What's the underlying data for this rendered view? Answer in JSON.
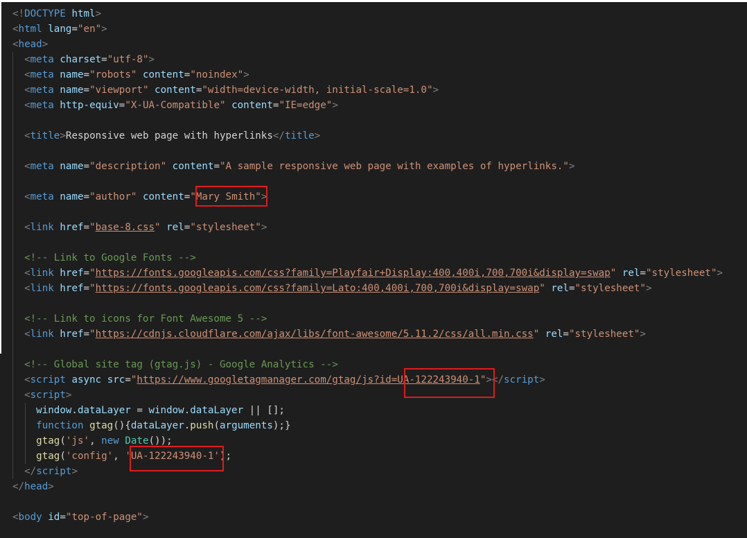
{
  "editor": {
    "lines": [
      {
        "parts": [
          {
            "c": "t-punc",
            "t": "<!"
          },
          {
            "c": "t-doctype",
            "t": "DOCTYPE"
          },
          {
            "c": "t-text",
            "t": " "
          },
          {
            "c": "t-html",
            "t": "html"
          },
          {
            "c": "t-punc",
            "t": ">"
          }
        ]
      },
      {
        "parts": [
          {
            "c": "t-punc",
            "t": "<"
          },
          {
            "c": "t-tag",
            "t": "html"
          },
          {
            "c": "t-text",
            "t": " "
          },
          {
            "c": "t-attr",
            "t": "lang"
          },
          {
            "c": "t-text",
            "t": "="
          },
          {
            "c": "t-str",
            "t": "\"en\""
          },
          {
            "c": "t-punc",
            "t": ">"
          }
        ]
      },
      {
        "parts": [
          {
            "c": "t-punc",
            "t": "<"
          },
          {
            "c": "t-tag",
            "t": "head"
          },
          {
            "c": "t-punc",
            "t": ">"
          }
        ]
      },
      {
        "indent": 1,
        "parts": [
          {
            "c": "t-punc",
            "t": "<"
          },
          {
            "c": "t-tag",
            "t": "meta"
          },
          {
            "c": "t-text",
            "t": " "
          },
          {
            "c": "t-attr",
            "t": "charset"
          },
          {
            "c": "t-text",
            "t": "="
          },
          {
            "c": "t-str",
            "t": "\"utf-8\""
          },
          {
            "c": "t-punc",
            "t": ">"
          }
        ]
      },
      {
        "indent": 1,
        "parts": [
          {
            "c": "t-punc",
            "t": "<"
          },
          {
            "c": "t-tag",
            "t": "meta"
          },
          {
            "c": "t-text",
            "t": " "
          },
          {
            "c": "t-attr",
            "t": "name"
          },
          {
            "c": "t-text",
            "t": "="
          },
          {
            "c": "t-str",
            "t": "\"robots\""
          },
          {
            "c": "t-text",
            "t": " "
          },
          {
            "c": "t-attr",
            "t": "content"
          },
          {
            "c": "t-text",
            "t": "="
          },
          {
            "c": "t-str",
            "t": "\"noindex\""
          },
          {
            "c": "t-punc",
            "t": ">"
          }
        ]
      },
      {
        "indent": 1,
        "parts": [
          {
            "c": "t-punc",
            "t": "<"
          },
          {
            "c": "t-tag",
            "t": "meta"
          },
          {
            "c": "t-text",
            "t": " "
          },
          {
            "c": "t-attr",
            "t": "name"
          },
          {
            "c": "t-text",
            "t": "="
          },
          {
            "c": "t-str",
            "t": "\"viewport\""
          },
          {
            "c": "t-text",
            "t": " "
          },
          {
            "c": "t-attr",
            "t": "content"
          },
          {
            "c": "t-text",
            "t": "="
          },
          {
            "c": "t-str",
            "t": "\"width=device-width, initial-scale=1.0\""
          },
          {
            "c": "t-punc",
            "t": ">"
          }
        ]
      },
      {
        "indent": 1,
        "parts": [
          {
            "c": "t-punc",
            "t": "<"
          },
          {
            "c": "t-tag",
            "t": "meta"
          },
          {
            "c": "t-text",
            "t": " "
          },
          {
            "c": "t-attr",
            "t": "http-equiv"
          },
          {
            "c": "t-text",
            "t": "="
          },
          {
            "c": "t-str",
            "t": "\"X-UA-Compatible\""
          },
          {
            "c": "t-text",
            "t": " "
          },
          {
            "c": "t-attr",
            "t": "content"
          },
          {
            "c": "t-text",
            "t": "="
          },
          {
            "c": "t-str",
            "t": "\"IE=edge\""
          },
          {
            "c": "t-punc",
            "t": ">"
          }
        ]
      },
      {
        "indent": 1,
        "parts": []
      },
      {
        "indent": 1,
        "parts": [
          {
            "c": "t-punc",
            "t": "<"
          },
          {
            "c": "t-tag",
            "t": "title"
          },
          {
            "c": "t-punc",
            "t": ">"
          },
          {
            "c": "t-text",
            "t": "Responsive web page with hyperlinks"
          },
          {
            "c": "t-punc",
            "t": "</"
          },
          {
            "c": "t-tag",
            "t": "title"
          },
          {
            "c": "t-punc",
            "t": ">"
          }
        ]
      },
      {
        "indent": 1,
        "parts": []
      },
      {
        "indent": 1,
        "parts": [
          {
            "c": "t-punc",
            "t": "<"
          },
          {
            "c": "t-tag",
            "t": "meta"
          },
          {
            "c": "t-text",
            "t": " "
          },
          {
            "c": "t-attr",
            "t": "name"
          },
          {
            "c": "t-text",
            "t": "="
          },
          {
            "c": "t-str",
            "t": "\"description\""
          },
          {
            "c": "t-text",
            "t": " "
          },
          {
            "c": "t-attr",
            "t": "content"
          },
          {
            "c": "t-text",
            "t": "="
          },
          {
            "c": "t-str",
            "t": "\"A sample responsive web page with examples of hyperlinks.\""
          },
          {
            "c": "t-punc",
            "t": ">"
          }
        ]
      },
      {
        "indent": 1,
        "parts": []
      },
      {
        "indent": 1,
        "parts": [
          {
            "c": "t-punc",
            "t": "<"
          },
          {
            "c": "t-tag",
            "t": "meta"
          },
          {
            "c": "t-text",
            "t": " "
          },
          {
            "c": "t-attr",
            "t": "name"
          },
          {
            "c": "t-text",
            "t": "="
          },
          {
            "c": "t-str",
            "t": "\"author\""
          },
          {
            "c": "t-text",
            "t": " "
          },
          {
            "c": "t-attr",
            "t": "content"
          },
          {
            "c": "t-text",
            "t": "="
          },
          {
            "c": "t-str",
            "t": "\"Mary Smith\""
          },
          {
            "c": "t-punc",
            "t": ">"
          }
        ]
      },
      {
        "indent": 1,
        "parts": []
      },
      {
        "indent": 1,
        "parts": [
          {
            "c": "t-punc",
            "t": "<"
          },
          {
            "c": "t-tag",
            "t": "link"
          },
          {
            "c": "t-text",
            "t": " "
          },
          {
            "c": "t-attr",
            "t": "href"
          },
          {
            "c": "t-text",
            "t": "="
          },
          {
            "c": "t-str",
            "t": "\""
          },
          {
            "c": "t-link",
            "t": "base-8.css"
          },
          {
            "c": "t-str",
            "t": "\""
          },
          {
            "c": "t-text",
            "t": " "
          },
          {
            "c": "t-attr",
            "t": "rel"
          },
          {
            "c": "t-text",
            "t": "="
          },
          {
            "c": "t-str",
            "t": "\"stylesheet\""
          },
          {
            "c": "t-punc",
            "t": ">"
          }
        ]
      },
      {
        "indent": 1,
        "parts": []
      },
      {
        "indent": 1,
        "parts": [
          {
            "c": "t-com",
            "t": "<!-- Link to Google Fonts -->"
          }
        ]
      },
      {
        "indent": 1,
        "parts": [
          {
            "c": "t-punc",
            "t": "<"
          },
          {
            "c": "t-tag",
            "t": "link"
          },
          {
            "c": "t-text",
            "t": " "
          },
          {
            "c": "t-attr",
            "t": "href"
          },
          {
            "c": "t-text",
            "t": "="
          },
          {
            "c": "t-str",
            "t": "\""
          },
          {
            "c": "t-link",
            "t": "https://fonts.googleapis.com/css?family=Playfair+Display:400,400i,700,700i&display=swap"
          },
          {
            "c": "t-str",
            "t": "\""
          },
          {
            "c": "t-text",
            "t": " "
          },
          {
            "c": "t-attr",
            "t": "rel"
          },
          {
            "c": "t-text",
            "t": "="
          },
          {
            "c": "t-str",
            "t": "\"stylesheet\""
          },
          {
            "c": "t-punc",
            "t": ">"
          }
        ]
      },
      {
        "indent": 1,
        "parts": [
          {
            "c": "t-punc",
            "t": "<"
          },
          {
            "c": "t-tag",
            "t": "link"
          },
          {
            "c": "t-text",
            "t": " "
          },
          {
            "c": "t-attr",
            "t": "href"
          },
          {
            "c": "t-text",
            "t": "="
          },
          {
            "c": "t-str",
            "t": "\""
          },
          {
            "c": "t-link",
            "t": "https://fonts.googleapis.com/css?family=Lato:400,400i,700,700i&display=swap"
          },
          {
            "c": "t-str",
            "t": "\""
          },
          {
            "c": "t-text",
            "t": " "
          },
          {
            "c": "t-attr",
            "t": "rel"
          },
          {
            "c": "t-text",
            "t": "="
          },
          {
            "c": "t-str",
            "t": "\"stylesheet\""
          },
          {
            "c": "t-punc",
            "t": ">"
          }
        ]
      },
      {
        "indent": 1,
        "parts": []
      },
      {
        "indent": 1,
        "parts": [
          {
            "c": "t-com",
            "t": "<!-- Link to icons for Font Awesome 5 -->"
          }
        ]
      },
      {
        "indent": 1,
        "parts": [
          {
            "c": "t-punc",
            "t": "<"
          },
          {
            "c": "t-tag",
            "t": "link"
          },
          {
            "c": "t-text",
            "t": " "
          },
          {
            "c": "t-attr",
            "t": "href"
          },
          {
            "c": "t-text",
            "t": "="
          },
          {
            "c": "t-str",
            "t": "\""
          },
          {
            "c": "t-link",
            "t": "https://cdnjs.cloudflare.com/ajax/libs/font-awesome/5.11.2/css/all.min.css"
          },
          {
            "c": "t-str",
            "t": "\""
          },
          {
            "c": "t-text",
            "t": " "
          },
          {
            "c": "t-attr",
            "t": "rel"
          },
          {
            "c": "t-text",
            "t": "="
          },
          {
            "c": "t-str",
            "t": "\"stylesheet\""
          },
          {
            "c": "t-punc",
            "t": ">"
          }
        ]
      },
      {
        "indent": 1,
        "parts": []
      },
      {
        "indent": 1,
        "parts": [
          {
            "c": "t-com",
            "t": "<!-- Global site tag (gtag.js) - Google Analytics -->"
          }
        ]
      },
      {
        "indent": 1,
        "parts": [
          {
            "c": "t-punc",
            "t": "<"
          },
          {
            "c": "t-tag",
            "t": "script"
          },
          {
            "c": "t-text",
            "t": " "
          },
          {
            "c": "t-attr",
            "t": "async"
          },
          {
            "c": "t-text",
            "t": " "
          },
          {
            "c": "t-attr",
            "t": "src"
          },
          {
            "c": "t-text",
            "t": "="
          },
          {
            "c": "t-str",
            "t": "\""
          },
          {
            "c": "t-link",
            "t": "https://www.googletagmanager.com/gtag/js?id=UA-122243940-1"
          },
          {
            "c": "t-str",
            "t": "\""
          },
          {
            "c": "t-punc",
            "t": "></"
          },
          {
            "c": "t-tag",
            "t": "script"
          },
          {
            "c": "t-punc",
            "t": ">"
          }
        ]
      },
      {
        "indent": 1,
        "parts": [
          {
            "c": "t-punc",
            "t": "<"
          },
          {
            "c": "t-tag",
            "t": "script"
          },
          {
            "c": "t-punc",
            "t": ">"
          }
        ]
      },
      {
        "indent": 2,
        "parts": [
          {
            "c": "t-var",
            "t": "window"
          },
          {
            "c": "t-op",
            "t": "."
          },
          {
            "c": "t-var",
            "t": "dataLayer"
          },
          {
            "c": "t-op",
            "t": " = "
          },
          {
            "c": "t-var",
            "t": "window"
          },
          {
            "c": "t-op",
            "t": "."
          },
          {
            "c": "t-var",
            "t": "dataLayer"
          },
          {
            "c": "t-op",
            "t": " || [];"
          }
        ]
      },
      {
        "indent": 2,
        "parts": [
          {
            "c": "t-kw",
            "t": "function"
          },
          {
            "c": "t-op",
            "t": " "
          },
          {
            "c": "t-fn",
            "t": "gtag"
          },
          {
            "c": "t-op",
            "t": "(){"
          },
          {
            "c": "t-var",
            "t": "dataLayer"
          },
          {
            "c": "t-op",
            "t": "."
          },
          {
            "c": "t-fn",
            "t": "push"
          },
          {
            "c": "t-op",
            "t": "("
          },
          {
            "c": "t-var",
            "t": "arguments"
          },
          {
            "c": "t-op",
            "t": ");}"
          }
        ]
      },
      {
        "indent": 2,
        "parts": [
          {
            "c": "t-fn",
            "t": "gtag"
          },
          {
            "c": "t-op",
            "t": "("
          },
          {
            "c": "t-str",
            "t": "'js'"
          },
          {
            "c": "t-op",
            "t": ", "
          },
          {
            "c": "t-kw",
            "t": "new"
          },
          {
            "c": "t-op",
            "t": " "
          },
          {
            "c": "t-class",
            "t": "Date"
          },
          {
            "c": "t-op",
            "t": "());"
          }
        ]
      },
      {
        "indent": 2,
        "parts": [
          {
            "c": "t-fn",
            "t": "gtag"
          },
          {
            "c": "t-op",
            "t": "("
          },
          {
            "c": "t-str",
            "t": "'config'"
          },
          {
            "c": "t-op",
            "t": ", "
          },
          {
            "c": "t-str",
            "t": "'UA-122243940-1'"
          },
          {
            "c": "t-op",
            "t": ");"
          }
        ]
      },
      {
        "indent": 1,
        "parts": [
          {
            "c": "t-punc",
            "t": "</"
          },
          {
            "c": "t-tag",
            "t": "script"
          },
          {
            "c": "t-punc",
            "t": ">"
          }
        ]
      },
      {
        "parts": [
          {
            "c": "t-punc",
            "t": "</"
          },
          {
            "c": "t-tag",
            "t": "head"
          },
          {
            "c": "t-punc",
            "t": ">"
          }
        ]
      },
      {
        "parts": []
      },
      {
        "parts": [
          {
            "c": "t-punc",
            "t": "<"
          },
          {
            "c": "t-tag",
            "t": "body"
          },
          {
            "c": "t-text",
            "t": " "
          },
          {
            "c": "t-attr",
            "t": "id"
          },
          {
            "c": "t-text",
            "t": "="
          },
          {
            "c": "t-str",
            "t": "\"top-of-page\""
          },
          {
            "c": "t-punc",
            "t": ">"
          }
        ]
      }
    ]
  },
  "highlights": [
    {
      "name": "highlight-author-name"
    },
    {
      "name": "highlight-script-tracking-id"
    },
    {
      "name": "highlight-config-tracking-id"
    }
  ],
  "colors": {
    "background": "#1e1e1e",
    "tag": "#569cd6",
    "attribute": "#9cdcfe",
    "string": "#ce9178",
    "comment": "#6a9955",
    "function": "#dcdcaa",
    "highlight_box": "#e11b1b"
  }
}
